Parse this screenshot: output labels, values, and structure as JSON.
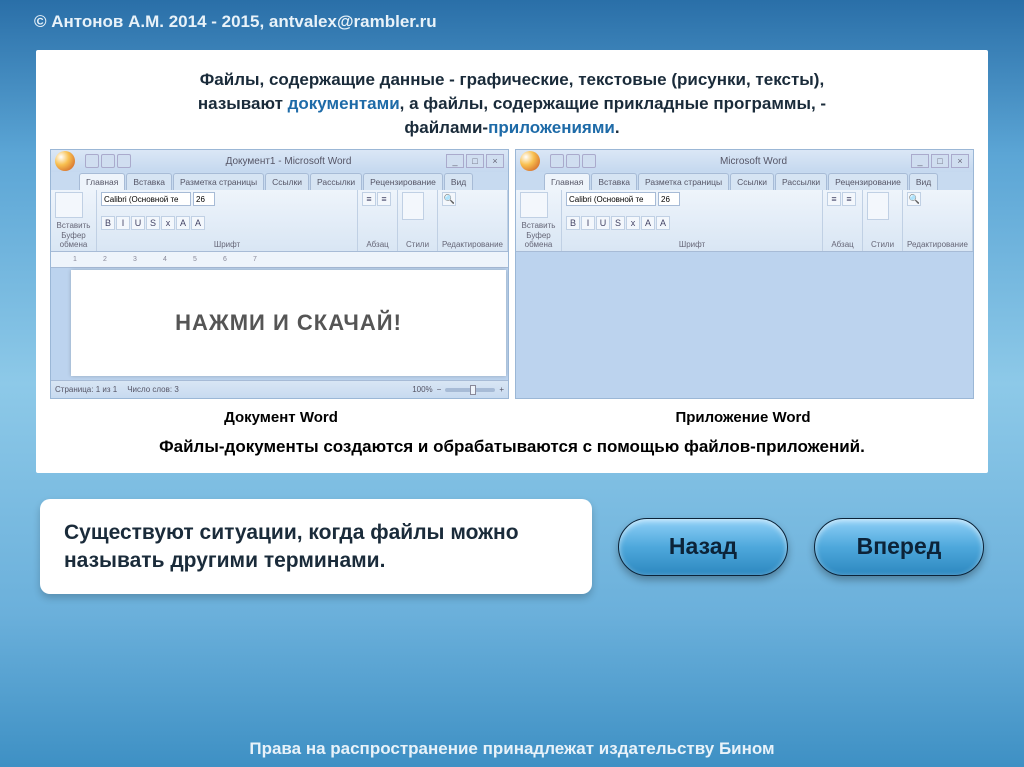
{
  "copyright": "© Антонов А.М. 2014 - 2015, antvalex@rambler.ru",
  "intro": {
    "line1_a": "Файлы, содержащие данные - графические, текстовые (рисунки, тексты),",
    "line2_a": "называют ",
    "line2_hl": "документами",
    "line2_b": ", а файлы, содержащие прикладные программы, -",
    "line3_a": "файлами-",
    "line3_hl": "приложениями",
    "line3_b": "."
  },
  "windows": {
    "left": {
      "title": "Документ1 - Microsoft Word",
      "tabs": [
        "Главная",
        "Вставка",
        "Разметка страницы",
        "Ссылки",
        "Рассылки",
        "Рецензирование",
        "Вид"
      ],
      "paste_label": "Вставить",
      "clipboard_label": "Буфер обмена",
      "font_name": "Calibri (Основной те",
      "font_size": "26",
      "group_font": "Шрифт",
      "group_para": "Абзац",
      "group_styles": "Стили",
      "group_edit": "Редактирование",
      "doc_text": "НАЖМИ И СКАЧАЙ!",
      "status_page": "Страница: 1 из 1",
      "status_words": "Число слов: 3",
      "status_zoom": "100%",
      "caption": "Документ Word"
    },
    "right": {
      "title": "Microsoft Word",
      "tabs": [
        "Главная",
        "Вставка",
        "Разметка страницы",
        "Ссылки",
        "Рассылки",
        "Рецензирование",
        "Вид"
      ],
      "paste_label": "Вставить",
      "clipboard_label": "Буфер обмена",
      "font_name": "Calibri (Основной те",
      "font_size": "26",
      "group_font": "Шрифт",
      "group_para": "Абзац",
      "group_styles": "Стили",
      "group_edit": "Редактирование",
      "caption": "Приложение Word"
    }
  },
  "bottom_sentence": "Файлы-документы создаются и обрабатываются с помощью файлов-приложений.",
  "info_box": "Существуют ситуации, когда файлы можно называть другими терминами.",
  "nav": {
    "back": "Назад",
    "forward": "Вперед"
  },
  "footer": "Права на распространение принадлежат издательству Бином"
}
